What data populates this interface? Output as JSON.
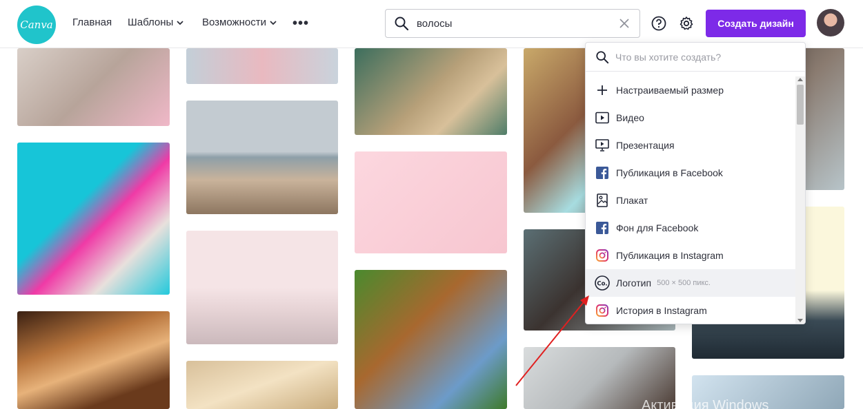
{
  "header": {
    "logo_text": "Canva",
    "nav": [
      {
        "label": "Главная"
      },
      {
        "label": "Шаблоны"
      },
      {
        "label": "Возможности"
      }
    ],
    "more_label": "•••",
    "search": {
      "value": "волосы"
    },
    "create_button": "Создать дизайн"
  },
  "dropdown": {
    "search_placeholder": "Что вы хотите создать?",
    "items": [
      {
        "label": "Настраиваемый размер",
        "icon": "plus-icon"
      },
      {
        "label": "Видео",
        "icon": "video-icon"
      },
      {
        "label": "Презентация",
        "icon": "presentation-icon"
      },
      {
        "label": "Публикация в Facebook",
        "icon": "facebook-icon"
      },
      {
        "label": "Плакат",
        "icon": "poster-icon"
      },
      {
        "label": "Фон для Facebook",
        "icon": "facebook-icon"
      },
      {
        "label": "Публикация в Instagram",
        "icon": "instagram-icon"
      },
      {
        "label": "Логотип",
        "meta": "500 × 500 пикс.",
        "icon": "logo-icon"
      },
      {
        "label": "История в Instagram",
        "icon": "instagram-icon"
      }
    ]
  },
  "watermark": "Активация Windows",
  "colors": {
    "brand": "#20c4cb",
    "create_button": "#7d2ae8",
    "arrow": "#e02020",
    "facebook": "#3b5998",
    "instagram": "#e1306c"
  }
}
